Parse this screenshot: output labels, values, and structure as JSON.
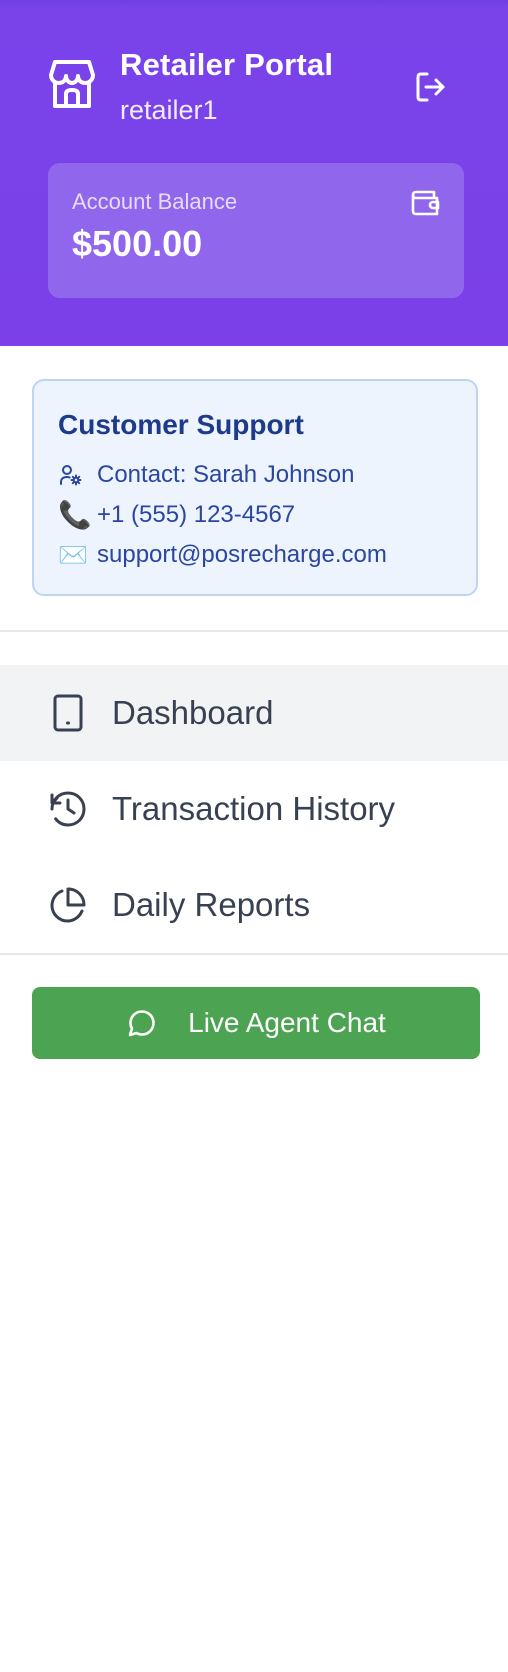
{
  "header": {
    "title": "Retailer Portal",
    "username": "retailer1",
    "logo_icon": "store-icon",
    "logout_icon": "logout-icon",
    "background_color": "#7b40e7"
  },
  "balance": {
    "label": "Account Balance",
    "amount": "$500.00",
    "icon": "wallet-icon"
  },
  "support": {
    "title": "Customer Support",
    "contact": "Contact: Sarah Johnson",
    "phone": "+1 (555) 123-4567",
    "email": "support@posrecharge.com",
    "background_color": "#edf4fd",
    "text_color": "#1e3a8a"
  },
  "nav": {
    "items": [
      {
        "label": "Dashboard",
        "icon": "tablet-icon",
        "active": true
      },
      {
        "label": "Transaction History",
        "icon": "history-icon",
        "active": false
      },
      {
        "label": "Daily Reports",
        "icon": "pie-chart-icon",
        "active": false
      }
    ]
  },
  "chat": {
    "label": "Live Agent Chat",
    "icon": "message-circle-icon",
    "color": "#4ca452"
  }
}
